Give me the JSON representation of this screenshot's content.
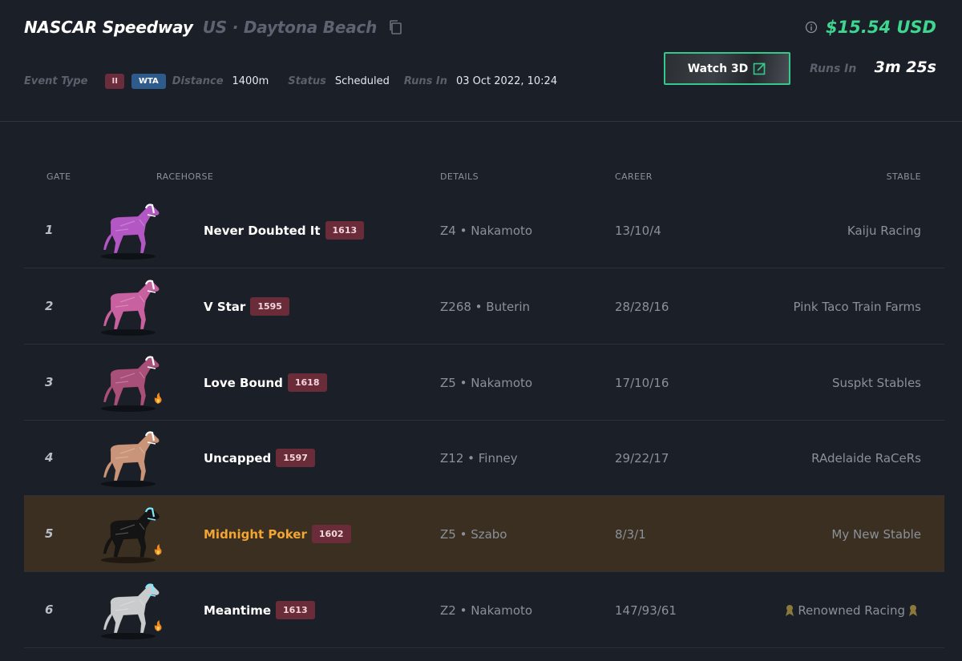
{
  "race": {
    "name": "NASCAR Speedway",
    "location": "US · Daytona Beach",
    "entry_fee": "$15.54 USD",
    "event_type_label": "Event Type",
    "class_badge": "II",
    "type_badge": "WTA",
    "distance_label": "Distance",
    "distance": "1400m",
    "status_label": "Status",
    "status": "Scheduled",
    "runs_in_label": "Runs In",
    "start_time": "03 Oct 2022, 10:24",
    "watch_label": "Watch 3D",
    "countdown_label": "Runs In",
    "countdown": "3m 25s"
  },
  "table": {
    "headers": {
      "gate": "GATE",
      "racehorse": "RACEHORSE",
      "details": "DETAILS",
      "career": "CAREER",
      "stable": "STABLE"
    },
    "rows": [
      {
        "gate": "1",
        "name": "Never Doubted It",
        "rating": "1613",
        "details": "Z4 • Nakamoto",
        "career": "13/10/4",
        "stable": "Kaiju Racing",
        "coat": "#b257c4",
        "mane": "#ffffff",
        "fire": false,
        "highlight": false,
        "ribbons": false
      },
      {
        "gate": "2",
        "name": "V Star",
        "rating": "1595",
        "details": "Z268 • Buterin",
        "career": "28/28/16",
        "stable": "Pink Taco Train Farms",
        "coat": "#c8619f",
        "mane": "#ffffff",
        "fire": false,
        "highlight": false,
        "ribbons": false
      },
      {
        "gate": "3",
        "name": "Love Bound",
        "rating": "1618",
        "details": "Z5 • Nakamoto",
        "career": "17/10/16",
        "stable": "Suspkt Stables",
        "coat": "#a84f7a",
        "mane": "#ffffff",
        "fire": true,
        "highlight": false,
        "ribbons": false
      },
      {
        "gate": "4",
        "name": "Uncapped",
        "rating": "1597",
        "details": "Z12 • Finney",
        "career": "29/22/17",
        "stable": "RAdelaide RaCeRs",
        "coat": "#c99478",
        "mane": "#ffffff",
        "fire": false,
        "highlight": false,
        "ribbons": false
      },
      {
        "gate": "5",
        "name": "Midnight Poker",
        "rating": "1602",
        "details": "Z5 • Szabo",
        "career": "8/3/1",
        "stable": "My New Stable",
        "coat": "#141414",
        "mane": "#7fe9ff",
        "fire": true,
        "highlight": true,
        "ribbons": false
      },
      {
        "gate": "6",
        "name": "Meantime",
        "rating": "1613",
        "details": "Z2 • Nakamoto",
        "career": "147/93/61",
        "stable": "Renowned Racing",
        "coat": "#c9cbcc",
        "mane": "#7fe9ff",
        "fire": true,
        "highlight": false,
        "ribbons": true
      }
    ]
  },
  "colors": {
    "accent_green": "#3fd68f",
    "highlight_name": "#f2a533",
    "rating_badge": "#6b2c3a"
  },
  "icons": {
    "copy": "copy-icon",
    "info": "info-icon",
    "external": "external-link-icon",
    "fire": "fire-icon",
    "ribbon": "award-ribbon-icon"
  }
}
